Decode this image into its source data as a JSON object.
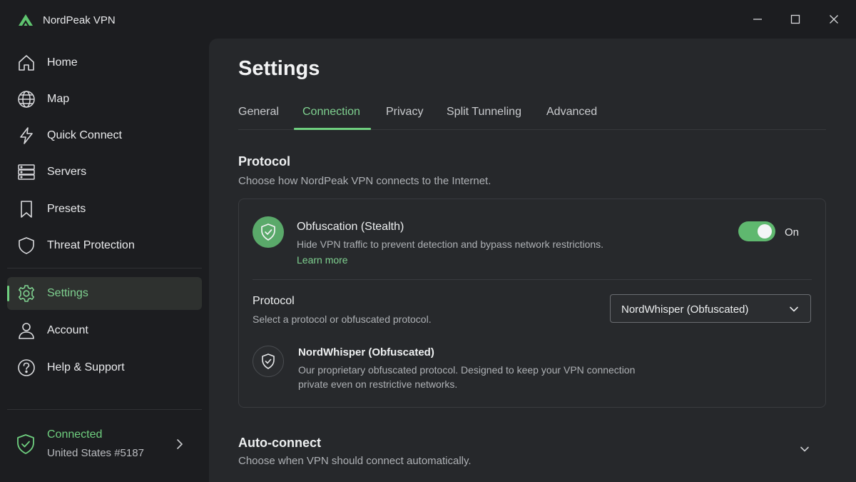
{
  "app": {
    "name": "NordPeak VPN",
    "accent": "#6fcf7f",
    "logo_icon": "mountain-logo-icon"
  },
  "window_controls": {
    "minimize_icon": "minimize-icon",
    "maximize_icon": "maximize-icon",
    "close_icon": "close-icon"
  },
  "sidebar": {
    "items": [
      {
        "label": "Home",
        "icon": "home-icon"
      },
      {
        "label": "Map",
        "icon": "globe-icon"
      },
      {
        "label": "Quick Connect",
        "icon": "lightning-icon"
      },
      {
        "label": "Servers",
        "icon": "server-stack-icon"
      },
      {
        "label": "Presets",
        "icon": "bookmark-icon"
      },
      {
        "label": "Threat Protection",
        "icon": "shield-icon"
      },
      {
        "label": "Settings",
        "icon": "gear-icon",
        "active": true
      },
      {
        "label": "Account",
        "icon": "person-icon"
      },
      {
        "label": "Help & Support",
        "icon": "question-circle-icon"
      }
    ],
    "status": {
      "title": "Connected",
      "server": "United States #5187",
      "icon": "shield-check-icon"
    }
  },
  "main": {
    "title": "Settings",
    "tabs": [
      {
        "label": "General"
      },
      {
        "label": "Connection",
        "active": true
      },
      {
        "label": "Privacy"
      },
      {
        "label": "Split Tunneling"
      },
      {
        "label": "Advanced"
      }
    ],
    "protocol_section": {
      "title": "Protocol",
      "description": "Choose how NordPeak VPN connects to the Internet.",
      "obfuscation": {
        "title": "Obfuscation (Stealth)",
        "description": "Hide VPN traffic to prevent detection and bypass network restrictions.",
        "learn_more": "Learn more",
        "toggle_on": true,
        "toggle_label": "On"
      },
      "protocol": {
        "label": "Protocol",
        "sublabel": "Select a protocol or obfuscated protocol.",
        "selected": "NordWhisper (Obfuscated)"
      },
      "protocol_info": {
        "title": "NordWhisper (Obfuscated)",
        "description": "Our proprietary obfuscated protocol. Designed to keep your VPN connection private even on restrictive networks."
      }
    },
    "autoconnect_section": {
      "title": "Auto-connect",
      "description": "Choose when VPN should connect automatically."
    }
  }
}
